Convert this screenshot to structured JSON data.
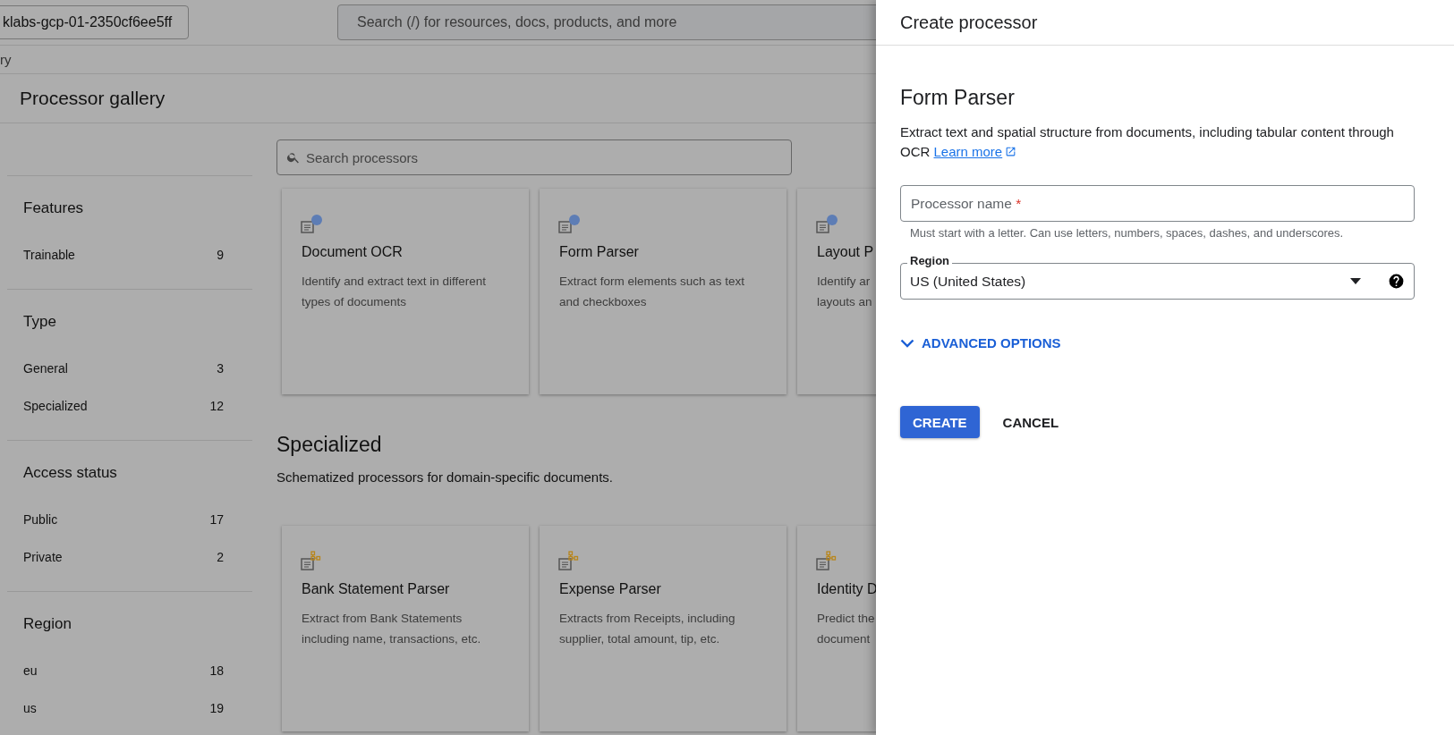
{
  "topbar": {
    "project": "klabs-gcp-01-2350cf6ee5ff",
    "search": {
      "placeholder": "Search (/) for resources, docs, products, and more"
    }
  },
  "breadcrumb": "ry",
  "page_title": "Processor gallery",
  "filters": [
    {
      "heading": "Features",
      "items": [
        {
          "label": "Trainable",
          "count": "9"
        }
      ]
    },
    {
      "heading": "Type",
      "items": [
        {
          "label": "General",
          "count": "3"
        },
        {
          "label": "Specialized",
          "count": "12"
        }
      ]
    },
    {
      "heading": "Access status",
      "items": [
        {
          "label": "Public",
          "count": "17"
        },
        {
          "label": "Private",
          "count": "2"
        }
      ]
    },
    {
      "heading": "Region",
      "items": [
        {
          "label": "eu",
          "count": "18"
        },
        {
          "label": "us",
          "count": "19"
        }
      ]
    }
  ],
  "search_processors": {
    "placeholder": "Search processors"
  },
  "sections": [
    {
      "cards": [
        {
          "kind": "general",
          "title": "Document OCR",
          "description_lines": [
            "Identify and extract text in different",
            "types of documents"
          ]
        },
        {
          "kind": "general",
          "title": "Form Parser",
          "description_lines": [
            "Extract form elements such as text",
            "and checkboxes"
          ]
        },
        {
          "kind": "general",
          "title": "Layout P",
          "description_lines": [
            "Identify ar",
            "layouts an"
          ]
        }
      ]
    },
    {
      "heading": "Specialized",
      "description": "Schematized processors for domain-specific documents.",
      "cards": [
        {
          "kind": "specialized",
          "title": "Bank Statement Parser",
          "description_lines": [
            "Extract from Bank Statements",
            "including name, transactions, etc."
          ]
        },
        {
          "kind": "specialized",
          "title": "Expense Parser",
          "description_lines": [
            "Extracts from Receipts, including",
            "supplier, total amount, tip, etc."
          ]
        },
        {
          "kind": "specialized",
          "title": "Identity D",
          "description_lines": [
            "Predict the",
            "document"
          ]
        }
      ]
    }
  ],
  "panel": {
    "title": "Create processor",
    "processor": "Form Parser",
    "description": "Extract text and spatial structure from documents, including tabular content through OCR",
    "learn_more": "Learn more",
    "name_field": {
      "placeholder": "Processor name",
      "required_mark": "*",
      "hint": "Must start with a letter. Can use letters, numbers, spaces, dashes, and underscores."
    },
    "region_field": {
      "label": "Region",
      "value": "US (United States)"
    },
    "advanced": {
      "label": "ADVANCED OPTIONS",
      "expanded": false
    },
    "buttons": [
      {
        "kind": "primary",
        "label": "CREATE"
      },
      {
        "kind": "text",
        "label": "CANCEL"
      }
    ]
  }
}
